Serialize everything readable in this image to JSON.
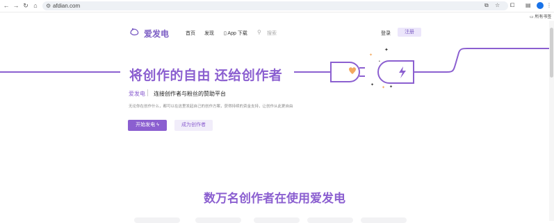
{
  "browser": {
    "url": "afdian.com",
    "bookmark_label": "所有书签",
    "icons": [
      "back-icon",
      "forward-icon",
      "reload-icon",
      "home-icon",
      "site-info-icon",
      "install-icon",
      "star-icon",
      "extensions-icon",
      "tab-search-icon",
      "profile-icon",
      "menu-icon",
      "folder-icon"
    ]
  },
  "site": {
    "logo_text": "爱发电",
    "nav": [
      "首页",
      "发现",
      "App 下载"
    ],
    "search_placeholder": "搜索",
    "login": "登录",
    "register": "注册"
  },
  "hero": {
    "title": "将创作的自由 还给创作者",
    "brand": "爱发电",
    "tagline": "连接创作者与粉丝的赞助平台",
    "description": "无论你在创作什么，都可以在这里发起自己的创作方案，获得持续的资金支持，让创作从此更自由",
    "start_button": "开始发电",
    "creator_button": "成为创作者"
  },
  "section": {
    "title": "数万名创作者在使用爱发电"
  },
  "colors": {
    "brand": "#8b5fd0",
    "brand_light": "#ece6fb",
    "heart": "#f3a95f"
  }
}
